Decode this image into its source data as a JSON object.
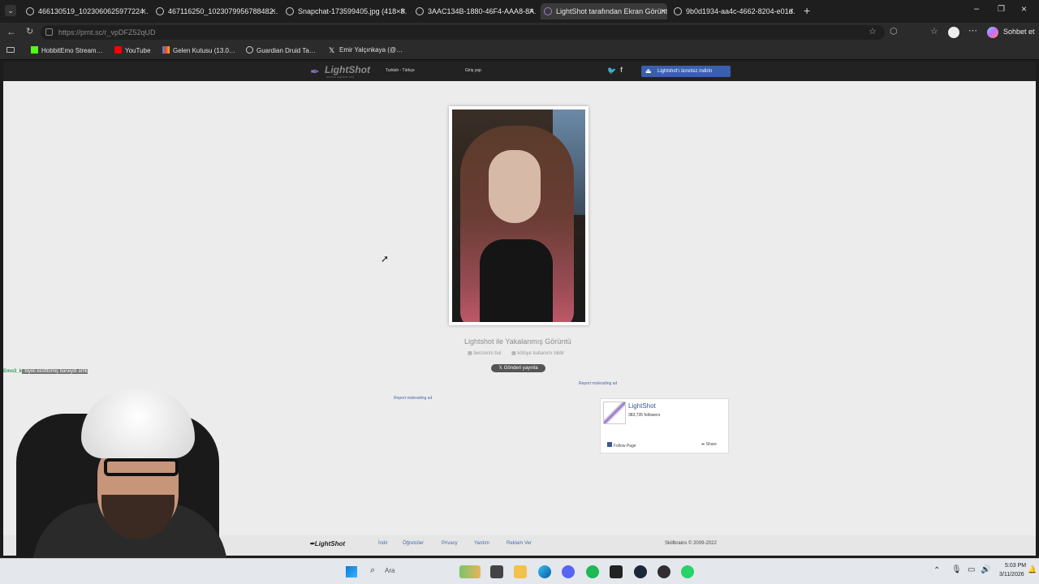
{
  "browser": {
    "tabs": [
      {
        "label": "466130519_1023060625977224…",
        "active": false
      },
      {
        "label": "467116250_1023079956788482…",
        "active": false
      },
      {
        "label": "Snapchat-173599405.jpg (418×8…",
        "active": false
      },
      {
        "label": "3AAC134B-1880-46F4-AAA8-8A…",
        "active": false
      },
      {
        "label": "LightShot tarafından Ekran Görünt…",
        "active": true
      },
      {
        "label": "9b0d1934-aa4c-4662-8204-e01d…",
        "active": false
      }
    ],
    "url": "https://prnt.sc/r_vpDFZ52qUD",
    "profile_label": "Sohbet et",
    "bookmarks": [
      {
        "label": "HobbitEmo Stream…",
        "icon": "kick-icon"
      },
      {
        "label": "YouTube",
        "icon": "youtube-icon"
      },
      {
        "label": "Gelen Kutusu (13.0…",
        "icon": "gmail-icon"
      },
      {
        "label": "Guardian Druid Ta…",
        "icon": "globe-icon"
      },
      {
        "label": "Emir Yalçınkaya (@…",
        "icon": "x-icon"
      }
    ]
  },
  "site": {
    "logo": "LightShot",
    "logo_tagline": "screen capture tool",
    "language": "Turkish - Türkçe",
    "login": "Giriş yap",
    "download_button": "Lightshot'ı ücretsiz indirin",
    "caption": "Lightshot ile Yakalanmış Görüntü",
    "caption_links": [
      "benzerini bul",
      "kötüye kullanımı bildir"
    ],
    "tweet_button": "Gönderi yayınla",
    "report_ad_1": "Report misleading ad",
    "report_ad_2": "Report misleading ad",
    "fb_widget": {
      "name": "LightShot",
      "followers": "383,735 followers",
      "follow": "Follow Page",
      "share": "Share"
    },
    "footer": {
      "logo": "LightShot",
      "links": [
        "İndir",
        "Öğretciler",
        "Privacy",
        "Yardım",
        "Reklam Ver"
      ],
      "copyright": "Skillbrains © 2009-2022"
    }
  },
  "stream_overlay": {
    "chat_user": "Emo3_k",
    "chat_message": ": biyiki kesfitomiş baneydi amk"
  },
  "taskbar": {
    "search_placeholder": "Ara",
    "time": "5:03 PM",
    "date": "3/11/2026"
  },
  "colors": {
    "accent_blue": "#3c5a99",
    "page_bg": "#ececec"
  }
}
